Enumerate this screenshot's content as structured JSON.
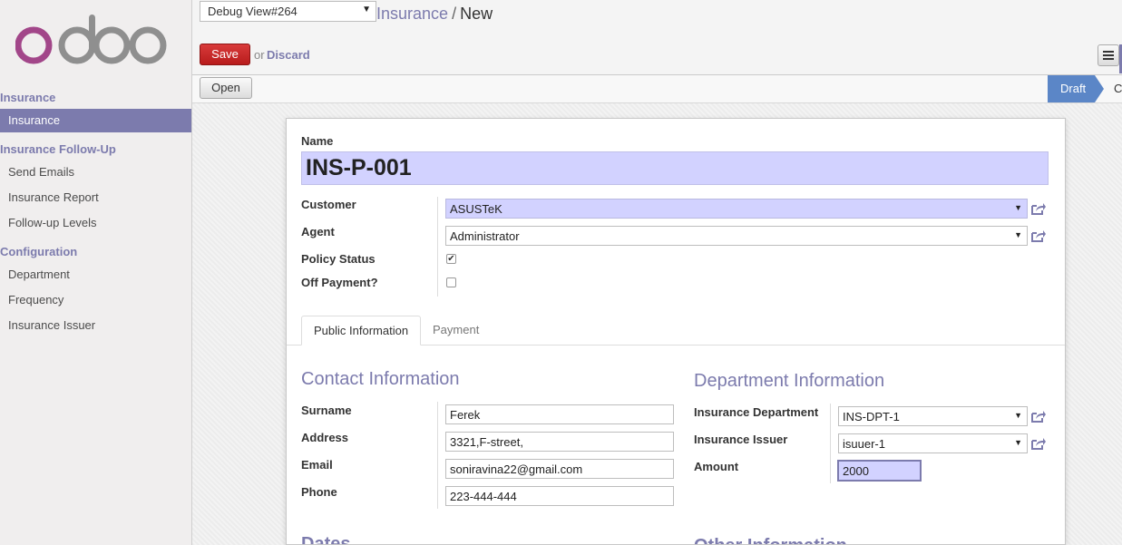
{
  "logo": {
    "text": "odoo"
  },
  "sidebar": {
    "sections": [
      {
        "title": "Insurance",
        "items": [
          {
            "label": "Insurance"
          }
        ]
      },
      {
        "title": "Insurance Follow-Up",
        "items": [
          {
            "label": "Send Emails"
          },
          {
            "label": "Insurance Report"
          },
          {
            "label": "Follow-up Levels"
          }
        ]
      },
      {
        "title": "Configuration",
        "items": [
          {
            "label": "Department"
          },
          {
            "label": "Frequency"
          },
          {
            "label": "Insurance Issuer"
          }
        ]
      }
    ]
  },
  "topbar": {
    "debug_view": "Debug View#264",
    "breadcrumb_parent": "Insurance",
    "breadcrumb_sep": "/",
    "breadcrumb_current": "New",
    "save_label": "Save",
    "or_label": "or",
    "discard_label": "Discard"
  },
  "statusbar": {
    "open_label": "Open",
    "stage_active": "Draft",
    "stage_next": "C"
  },
  "form": {
    "name_label": "Name",
    "name_value": "INS-P-001",
    "customer_label": "Customer",
    "customer_value": "ASUSTeK",
    "agent_label": "Agent",
    "agent_value": "Administrator",
    "policy_status_label": "Policy Status",
    "policy_status_checked": true,
    "off_payment_label": "Off Payment?",
    "off_payment_checked": false
  },
  "tabs": [
    {
      "label": "Public Information"
    },
    {
      "label": "Payment"
    }
  ],
  "contact": {
    "title": "Contact Information",
    "surname_label": "Surname",
    "surname_value": "Ferek",
    "address_label": "Address",
    "address_value": "3321,F-street,",
    "email_label": "Email",
    "email_value": "soniravina22@gmail.com",
    "phone_label": "Phone",
    "phone_value": "223-444-444"
  },
  "department": {
    "title": "Department Information",
    "dept_label": "Insurance Department",
    "dept_value": "INS-DPT-1",
    "issuer_label": "Insurance Issuer",
    "issuer_value": "isuuer-1",
    "amount_label": "Amount",
    "amount_value": "2000"
  },
  "lower_sections": {
    "dates_title": "Dates",
    "other_title": "Other Information"
  },
  "colors": {
    "accent": "#7c7bad",
    "save": "#c92a2a",
    "stage": "#5b86c7",
    "required_field": "#d2d2ff"
  }
}
